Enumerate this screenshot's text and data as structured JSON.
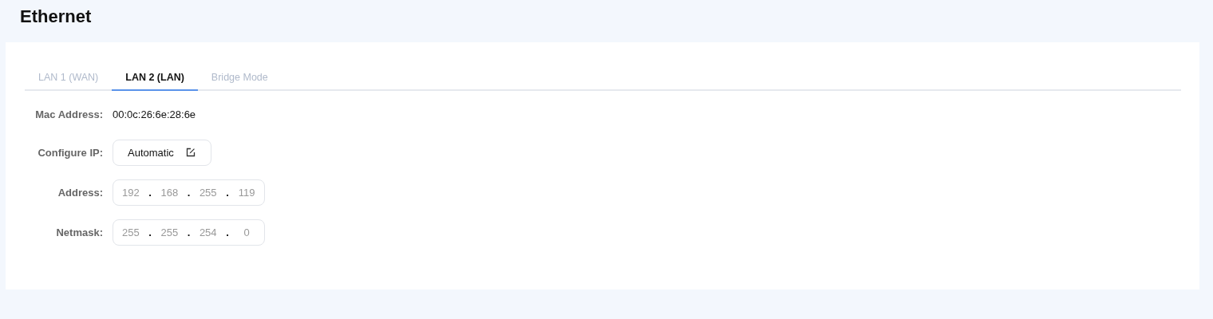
{
  "title": "Ethernet",
  "tabs": [
    {
      "label": "LAN 1 (WAN)",
      "selected": false
    },
    {
      "label": "LAN 2 (LAN)",
      "selected": true
    },
    {
      "label": "Bridge Mode",
      "selected": false
    }
  ],
  "fields": [
    {
      "kind": "text",
      "label": "Mac Address:",
      "value": "00:0c:26:6e:28:6e"
    },
    {
      "kind": "button",
      "label": "Configure IP:",
      "value": "Automatic"
    },
    {
      "kind": "ip",
      "label": "Address:",
      "octets": [
        "192",
        "168",
        "255",
        "119"
      ],
      "separator": "."
    },
    {
      "kind": "ip",
      "label": "Netmask:",
      "octets": [
        "255",
        "255",
        "254",
        "0"
      ],
      "separator": "."
    }
  ]
}
